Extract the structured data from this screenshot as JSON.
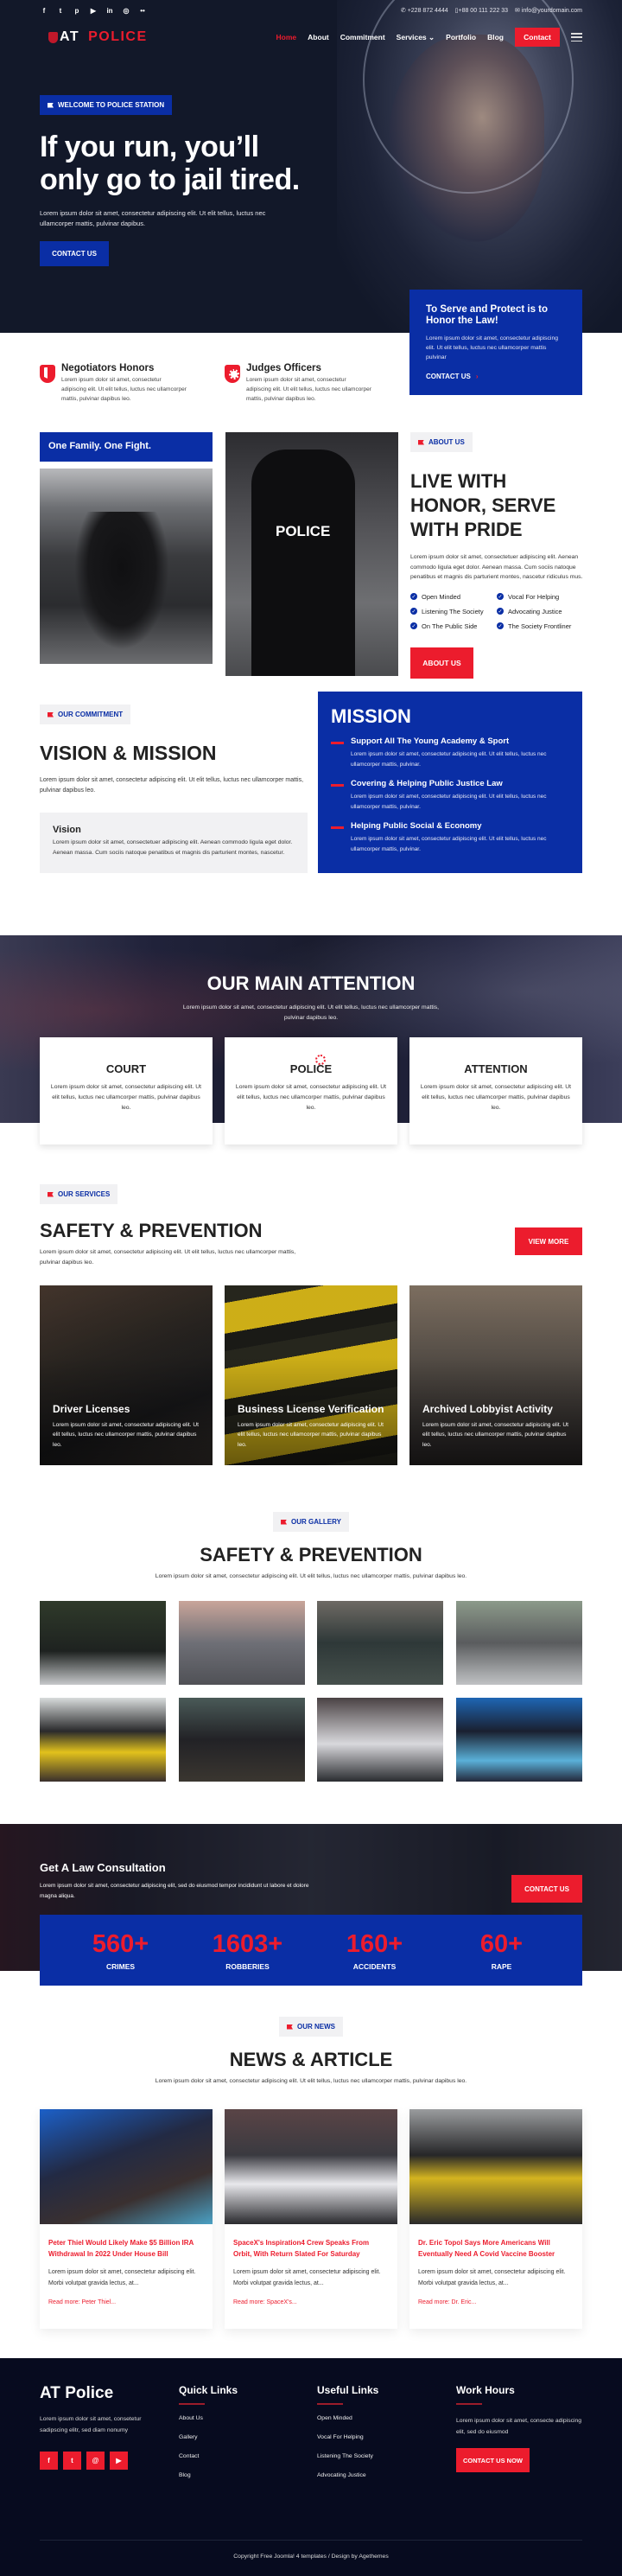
{
  "topbar": {
    "socials": [
      "facebook-icon",
      "twitter-icon",
      "pinterest-icon",
      "youtube-icon",
      "linkedin-icon",
      "instagram-icon",
      "flickr-icon"
    ],
    "phone": "+228 872 4444",
    "mobile": "+88 00 111 222 33",
    "email": "info@yourdomain.com"
  },
  "nav": {
    "logo_prefix": "AT",
    "logo_main": "POLICE",
    "items": [
      "Home",
      "About",
      "Commitment",
      "Services",
      "Portfolio",
      "Blog"
    ],
    "active": "Home",
    "contact": "Contact"
  },
  "hero": {
    "tag": "WELCOME TO POLICE STATION",
    "title": "If you run, you’ll only go to jail tired.",
    "text": "Lorem ipsum dolor sit amet, consectetur adipiscing elit. Ut elit tellus, luctus nec ullamcorper mattis, pulvinar dapibus.",
    "button": "CONTACT US"
  },
  "features": [
    {
      "title": "Negotiators Honors",
      "text": "Lorem ipsum dolor sit amet, consectetur adipiscing elit. Ut elit tellus, luctus nec ullamcorper mattis, pulvinar dapibus leo."
    },
    {
      "title": "Judges Officers",
      "text": "Lorem ipsum dolor sit amet, consectetur adipiscing elit. Ut elit tellus, luctus nec ullamcorper mattis, pulvinar dapibus leo."
    }
  ],
  "serve": {
    "title": "To Serve and Protect is to Honor the Law!",
    "text": "Lorem ipsum dolor sit amet, consectetur adipiscing elit. Ut elit tellus, luctus nec ullamcorper mattis pulvinar",
    "link": "CONTACT US",
    "arrow": "›"
  },
  "about": {
    "banner": "One Family. One Fight.",
    "tag": "ABOUT US",
    "title": "LIVE WITH HONOR, SERVE WITH PRIDE",
    "text": "Lorem ipsum dolor sit amet, consectetuer adipiscing elit. Aenean commodo ligula eget dolor. Aenean massa. Cum sociis natoque penatibus et magnis dis parturient montes, nascetur ridiculus mus.",
    "checks": [
      "Open Minded",
      "Vocal For Helping",
      "Listening The Society",
      "Advocating Justice",
      "On The Public Side",
      "The Society Frontliner"
    ],
    "button": "ABOUT US"
  },
  "vision": {
    "tag": "OUR COMMITMENT",
    "title": "VISION & MISSION",
    "text": "Lorem ipsum dolor sit amet, consectetur adipiscing elit. Ut elit tellus, luctus nec ullamcorper mattis, pulvinar dapibus leo.",
    "box_title": "Vision",
    "box_text": "Lorem ipsum dolor sit amet, consectetuer adipiscing elit. Aenean commodo ligula eget dolor. Aenean massa. Cum sociis natoque penatibus et magnis dis parturient montes, nascetur.",
    "mission_title": "MISSION",
    "mission_items": [
      {
        "title": "Support All The Young Academy & Sport",
        "text": "Lorem ipsum dolor sit amet, consectetur adipiscing elit. Ut elit tellus, luctus nec ullamcorper mattis, pulvinar."
      },
      {
        "title": "Covering & Helping Public Justice Law",
        "text": "Lorem ipsum dolor sit amet, consectetur adipiscing elit. Ut elit tellus, luctus nec ullamcorper mattis, pulvinar."
      },
      {
        "title": "Helping Public Social & Economy",
        "text": "Lorem ipsum dolor sit amet, consectetur adipiscing elit. Ut elit tellus, luctus nec ullamcorper mattis, pulvinar."
      }
    ]
  },
  "attention": {
    "title": "OUR MAIN ATTENTION",
    "text": "Lorem ipsum dolor sit amet, consectetur adipiscing elit. Ut elit tellus, luctus nec ullamcorper mattis, pulvinar dapibus leo.",
    "cards": [
      {
        "title": "COURT",
        "text": "Lorem ipsum dolor sit amet, consectetur adipiscing elit. Ut elit tellus, luctus nec ullamcorper mattis, pulvinar dapibus leo."
      },
      {
        "title": "POLICE",
        "text": "Lorem ipsum dolor sit amet, consectetur adipiscing elit. Ut elit tellus, luctus nec ullamcorper mattis, pulvinar dapibus leo."
      },
      {
        "title": "ATTENTION",
        "text": "Lorem ipsum dolor sit amet, consectetur adipiscing elit. Ut elit tellus, luctus nec ullamcorper mattis, pulvinar dapibus leo."
      }
    ]
  },
  "services": {
    "tag": "OUR SERVICES",
    "title": "SAFETY & PREVENTION",
    "text": "Lorem ipsum dolor sit amet, consectetur adipiscing elit. Ut elit tellus, luctus nec ullamcorper mattis, pulvinar dapibus leo.",
    "button": "VIEW MORE",
    "cards": [
      {
        "title": "Driver Licenses",
        "text": "Lorem ipsum dolor sit amet, consectetur adipiscing elit. Ut elit tellus, luctus nec ullamcorper mattis, pulvinar dapibus leo."
      },
      {
        "title": "Business License Verification",
        "text": "Lorem ipsum dolor sit amet, consectetur adipiscing elit. Ut elit tellus, luctus nec ullamcorper mattis, pulvinar dapibus leo."
      },
      {
        "title": "Archived Lobbyist Activity",
        "text": "Lorem ipsum dolor sit amet, consectetur adipiscing elit. Ut elit tellus, luctus nec ullamcorper mattis, pulvinar dapibus leo."
      }
    ]
  },
  "gallery": {
    "tag": "OUR GALLERY",
    "title": "SAFETY & PREVENTION",
    "text": "Lorem ipsum dolor sit amet, consectetur adipiscing elit. Ut elit tellus, luctus nec ullamcorper mattis, pulvinar dapibus leo."
  },
  "consult": {
    "title": "Get A Law Consultation",
    "text": "Lorem ipsum dolor sit amet, consectetur adipiscing elit, sed do eiusmod tempor incididunt ut labore et dolore magna aliqua.",
    "button": "CONTACT US"
  },
  "stats": [
    {
      "num": "560+",
      "label": "CRIMES"
    },
    {
      "num": "1603+",
      "label": "ROBBERIES"
    },
    {
      "num": "160+",
      "label": "ACCIDENTS"
    },
    {
      "num": "60+",
      "label": "RAPE"
    }
  ],
  "news": {
    "tag": "OUR NEWS",
    "title": "NEWS & ARTICLE",
    "text": "Lorem ipsum dolor sit amet, consectetur adipiscing elit. Ut elit tellus, luctus nec ullamcorper mattis, pulvinar dapibus leo.",
    "articles": [
      {
        "title": "Peter Thiel Would Likely Make $5 Billion IRA Withdrawal In 2022 Under House Bill",
        "text": "Lorem ipsum dolor sit amet, consectetur adipiscing elit. Morbi volutpat gravida lectus, at...",
        "more": "Read more: Peter Thiel..."
      },
      {
        "title": "SpaceX's Inspiration4 Crew Speaks From Orbit, With Return Slated For Saturday",
        "text": "Lorem ipsum dolor sit amet, consectetur adipiscing elit. Morbi volutpat gravida lectus, at...",
        "more": "Read more: SpaceX's..."
      },
      {
        "title": "Dr. Eric Topol Says More Americans Will Eventually Need A Covid Vaccine Booster",
        "text": "Lorem ipsum dolor sit amet, consectetur adipiscing elit. Morbi volutpat gravida lectus, at...",
        "more": "Read more: Dr. Eric..."
      }
    ]
  },
  "footer": {
    "brand": "AT Police",
    "brand_text": "Lorem ipsum dolor sit amet, consetetur sadipscing elitr, sed diam nonumy",
    "quick_title": "Quick Links",
    "quick_links": [
      "About Us",
      "Gallery",
      "Contact",
      "Blog"
    ],
    "useful_title": "Useful Links",
    "useful_links": [
      "Open Minded",
      "Vocal For Helping",
      "Listening The Society",
      "Advocating Justice"
    ],
    "hours_title": "Work Hours",
    "hours_text": "Lorem ipsum dolor sit amet, consecte adipiscing elit, sed do eiusmod",
    "button": "CONTACT US NOW",
    "copyright": "Copyright Free Joomla! 4 templates / Design by Agethemes"
  },
  "colors": {
    "brand_blue": "#0a2ea5",
    "accent_red": "#ec1c2d",
    "dark_navy": "#121829",
    "footer_navy": "#070b1f"
  }
}
